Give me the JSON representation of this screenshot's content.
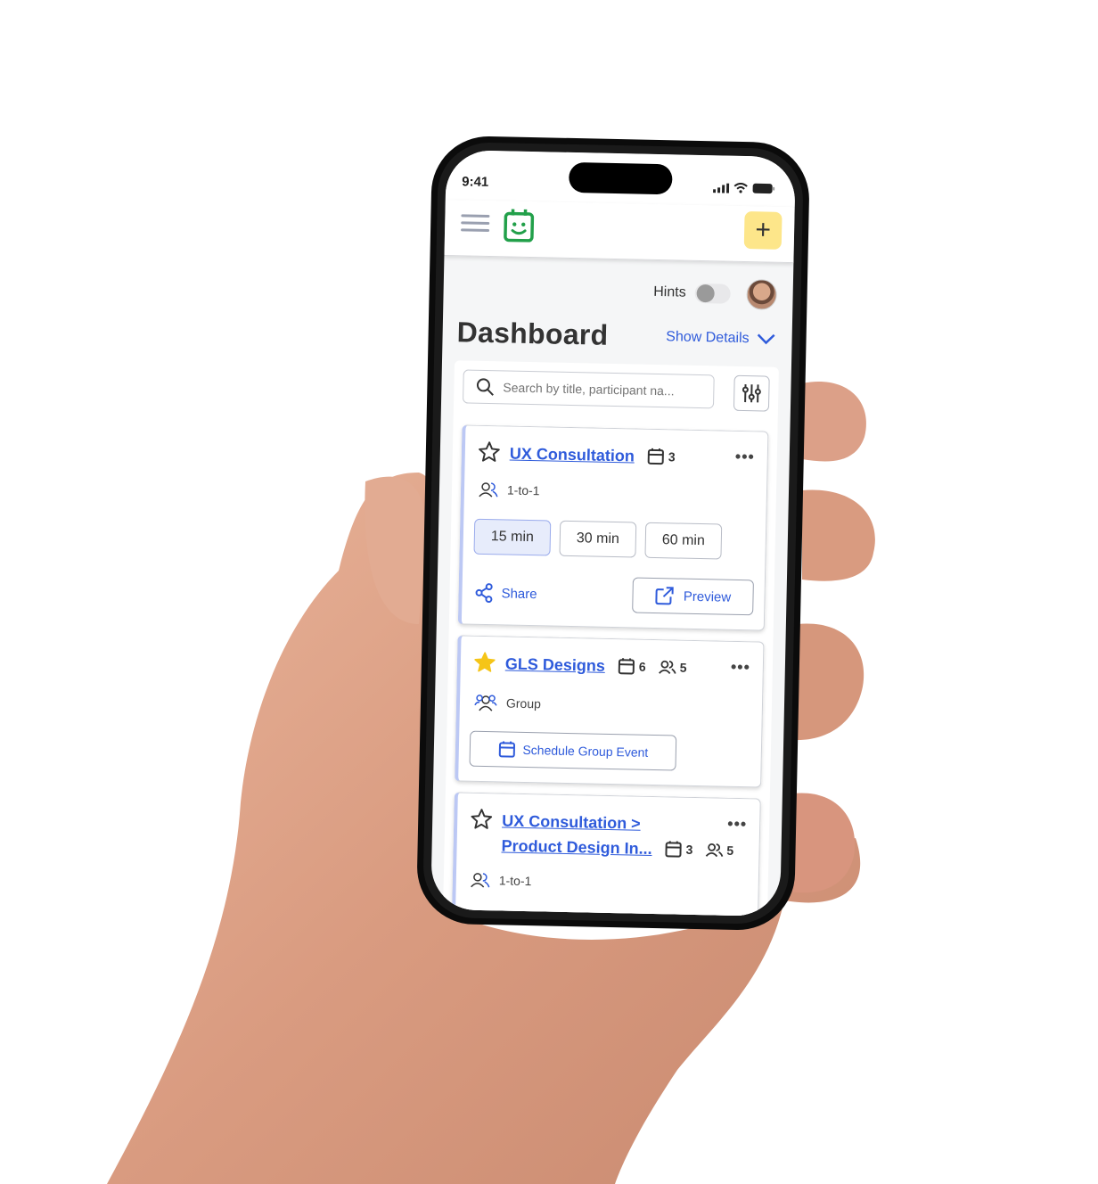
{
  "status_bar": {
    "time": "9:41"
  },
  "header": {
    "add_label": "+"
  },
  "hints": {
    "label": "Hints",
    "enabled": false
  },
  "page": {
    "title": "Dashboard",
    "show_details_label": "Show Details"
  },
  "search": {
    "placeholder": "Search by title, participant na..."
  },
  "colors": {
    "accent": "#2f5bdb",
    "add_button": "#fde68a",
    "logo": "#22a04a",
    "star_active": "#f5c518"
  },
  "cards": [
    {
      "title": "UX Consultation",
      "starred": false,
      "events_count": "3",
      "type": "1-to-1",
      "durations": [
        "15 min",
        "30 min",
        "60 min"
      ],
      "selected_duration": "15 min",
      "share_label": "Share",
      "preview_label": "Preview"
    },
    {
      "title": "GLS Designs",
      "starred": true,
      "events_count": "6",
      "members_count": "5",
      "type": "Group",
      "schedule_label": "Schedule Group Event"
    },
    {
      "title_line1": "UX Consultation >",
      "title_line2": "Product Design In...",
      "starred": false,
      "events_count": "3",
      "members_count": "5",
      "type": "1-to-1"
    }
  ]
}
